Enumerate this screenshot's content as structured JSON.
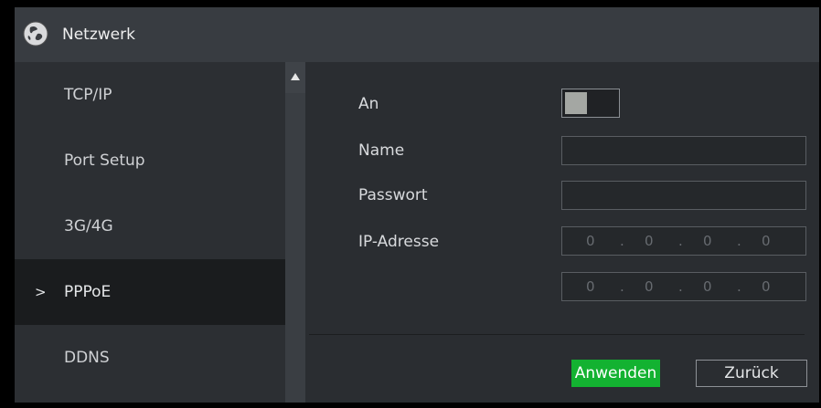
{
  "window": {
    "title": "Netzwerk",
    "logo_icon": "globe-icon"
  },
  "sidebar": {
    "items": [
      {
        "label": "TCP/IP",
        "active": false
      },
      {
        "label": "Port Setup",
        "active": false
      },
      {
        "label": "3G/4G",
        "active": false
      },
      {
        "label": "PPPoE",
        "active": true
      },
      {
        "label": "DDNS",
        "active": false
      }
    ],
    "active_marker": ">"
  },
  "form": {
    "enable_label": "An",
    "enable_state": "off",
    "name_label": "Name",
    "name_value": "",
    "password_label": "Passwort",
    "password_value": "",
    "ip_label": "IP-Adresse",
    "ip_address": [
      "0",
      "0",
      "0",
      "0"
    ],
    "ip_address_2": [
      "0",
      "0",
      "0",
      "0"
    ],
    "ip_separator": "."
  },
  "buttons": {
    "apply_label": "Anwenden",
    "back_label": "Zurück"
  },
  "colors": {
    "apply_bg": "#13b231",
    "active_item_bg": "#1a1c1e"
  }
}
